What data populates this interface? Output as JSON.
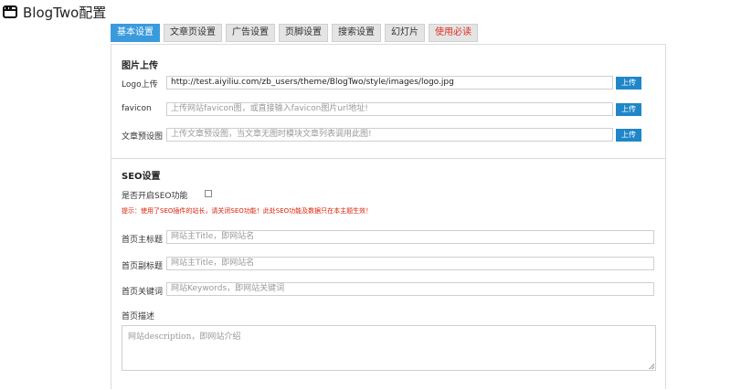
{
  "app": {
    "title": "BlogTwo配置"
  },
  "tabs": [
    {
      "label": "基本设置",
      "active": true
    },
    {
      "label": "文章页设置"
    },
    {
      "label": "广告设置"
    },
    {
      "label": "页脚设置"
    },
    {
      "label": "搜索设置"
    },
    {
      "label": "幻灯片"
    },
    {
      "label": "使用必读",
      "warn": true
    }
  ],
  "image_upload": {
    "title": "图片上传",
    "logo": {
      "label": "Logo上传",
      "value": "http://test.aiyiliu.com/zb_users/theme/BlogTwo/style/images/logo.jpg",
      "button": "上传"
    },
    "favicon": {
      "label": "favicon",
      "placeholder": "上传网站favicon图，或直接输入favicon图片url地址!",
      "button": "上传"
    },
    "preview": {
      "label": "文章预设图",
      "placeholder": "上传文章预设图，当文章无图时模块文章列表调用此图!",
      "button": "上传"
    }
  },
  "seo": {
    "title": "SEO设置",
    "enable_label": "是否开启SEO功能",
    "hint": "提示：使用了SEO插件的站长，请关闭SEO功能！此处SEO功能及数据只在本主题生效！",
    "home_title": {
      "label": "首页主标题",
      "placeholder": "网站主Title，即网站名"
    },
    "home_subtitle": {
      "label": "首页副标题",
      "placeholder": "网站主Title，即网站名"
    },
    "home_keywords": {
      "label": "首页关键词",
      "placeholder": "网站Keywords，即网站关键词"
    },
    "home_desc": {
      "label": "首页描述",
      "placeholder": "网站description，即网站介绍"
    }
  },
  "colors": {
    "accent": "#3a9bdc",
    "upload_button": "#1f87c8",
    "warn": "#d81e06"
  }
}
